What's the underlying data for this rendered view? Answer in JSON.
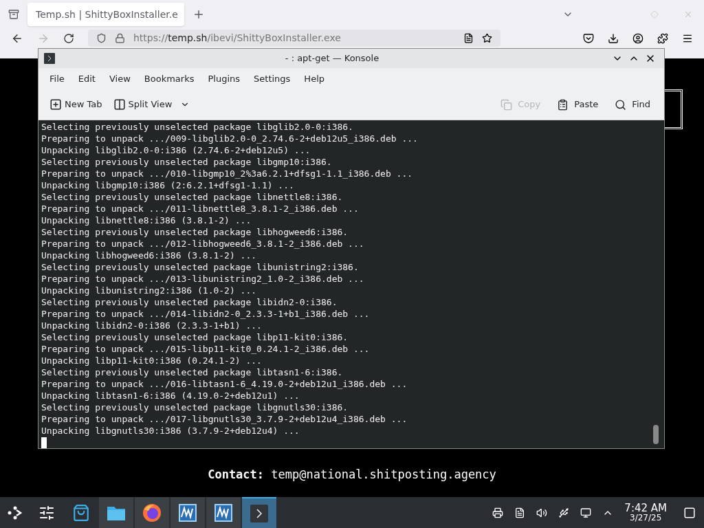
{
  "browser": {
    "tab": {
      "title": "Temp.sh | ShittyBoxInstaller.e",
      "selected": true
    },
    "url": {
      "scheme": "https://",
      "domain": "temp.sh",
      "path": "/ibevi/ShittyBoxInstaller.exe"
    }
  },
  "page": {
    "contact_label": "Contact:",
    "contact_value": "temp@national.shitposting.agency"
  },
  "konsole": {
    "title": "- : apt-get — Konsole",
    "menu": [
      "File",
      "Edit",
      "View",
      "Bookmarks",
      "Plugins",
      "Settings",
      "Help"
    ],
    "toolbar_left": [
      {
        "kind": "newtab",
        "label": "New Tab",
        "disabled": false
      },
      {
        "kind": "split",
        "label": "Split View",
        "disabled": false
      }
    ],
    "toolbar_right": [
      {
        "kind": "copy",
        "label": "Copy",
        "disabled": true
      },
      {
        "kind": "paste",
        "label": "Paste",
        "disabled": false
      },
      {
        "kind": "find",
        "label": "Find",
        "disabled": false
      }
    ],
    "lines": [
      "Selecting previously unselected package libglib2.0-0:i386.",
      "Preparing to unpack .../009-libglib2.0-0_2.74.6-2+deb12u5_i386.deb ...",
      "Unpacking libglib2.0-0:i386 (2.74.6-2+deb12u5) ...",
      "Selecting previously unselected package libgmp10:i386.",
      "Preparing to unpack .../010-libgmp10_2%3a6.2.1+dfsg1-1.1_i386.deb ...",
      "Unpacking libgmp10:i386 (2:6.2.1+dfsg1-1.1) ...",
      "Selecting previously unselected package libnettle8:i386.",
      "Preparing to unpack .../011-libnettle8_3.8.1-2_i386.deb ...",
      "Unpacking libnettle8:i386 (3.8.1-2) ...",
      "Selecting previously unselected package libhogweed6:i386.",
      "Preparing to unpack .../012-libhogweed6_3.8.1-2_i386.deb ...",
      "Unpacking libhogweed6:i386 (3.8.1-2) ...",
      "Selecting previously unselected package libunistring2:i386.",
      "Preparing to unpack .../013-libunistring2_1.0-2_i386.deb ...",
      "Unpacking libunistring2:i386 (1.0-2) ...",
      "Selecting previously unselected package libidn2-0:i386.",
      "Preparing to unpack .../014-libidn2-0_2.3.3-1+b1_i386.deb ...",
      "Unpacking libidn2-0:i386 (2.3.3-1+b1) ...",
      "Selecting previously unselected package libp11-kit0:i386.",
      "Preparing to unpack .../015-libp11-kit0_0.24.1-2_i386.deb ...",
      "Unpacking libp11-kit0:i386 (0.24.1-2) ...",
      "Selecting previously unselected package libtasn1-6:i386.",
      "Preparing to unpack .../016-libtasn1-6_4.19.0-2+deb12u1_i386.deb ...",
      "Unpacking libtasn1-6:i386 (4.19.0-2+deb12u1) ...",
      "Selecting previously unselected package libgnutls30:i386.",
      "Preparing to unpack .../017-libgnutls30_3.7.9-2+deb12u4_i386.deb ...",
      "Unpacking libgnutls30:i386 (3.7.9-2+deb12u4) ..."
    ]
  },
  "taskbar": {
    "tasks": [
      {
        "kind": "files",
        "selected": false
      },
      {
        "kind": "firefox",
        "selected": false
      },
      {
        "kind": "vm",
        "selected": false
      },
      {
        "kind": "vm",
        "selected": false
      },
      {
        "kind": "terminal",
        "selected": true
      }
    ],
    "time": "7:42 AM",
    "date": "3/27/25"
  }
}
